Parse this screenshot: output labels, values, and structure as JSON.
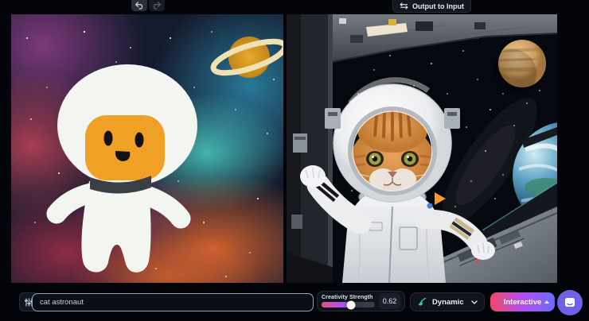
{
  "header": {
    "undo_tooltip": "Undo",
    "redo_tooltip": "Redo",
    "output_to_input_label": "Output to Input"
  },
  "canvases": {
    "input": {
      "alt": "Drawing canvas: white doodle astronaut with orange face on colorful nebula, Saturn doodle top right"
    },
    "output": {
      "alt": "Generated image: realistic cat in white astronaut suit inside spacecraft, Jupiter and Earth seen through window"
    }
  },
  "bottom_bar": {
    "prompt": {
      "value": "cat astronaut"
    },
    "creativity": {
      "label": "Creativity Strength",
      "value": "0.62"
    },
    "style_dropdown": {
      "value": "Dynamic"
    },
    "interactive_button": {
      "label": "Interactive"
    }
  },
  "icons": {
    "undo": "undo-arrow",
    "redo": "redo-arrow",
    "output_to_input": "swap-arrows",
    "settings": "sliders",
    "style": "paintbrush",
    "dropdown": "chevron-down",
    "interactive": "caret-up",
    "chat": "chat-bubble"
  },
  "colors": {
    "accent_gradient": [
      "#ee4866",
      "#b04ef0",
      "#6d6cf8"
    ],
    "slider_gradient": [
      "#e4527e",
      "#b44fe9",
      "#7e5bf4"
    ],
    "chat_widget": "#6e62e8",
    "prompt_border": "#90a4bf",
    "style_icon_green": "#3ecf8e"
  }
}
